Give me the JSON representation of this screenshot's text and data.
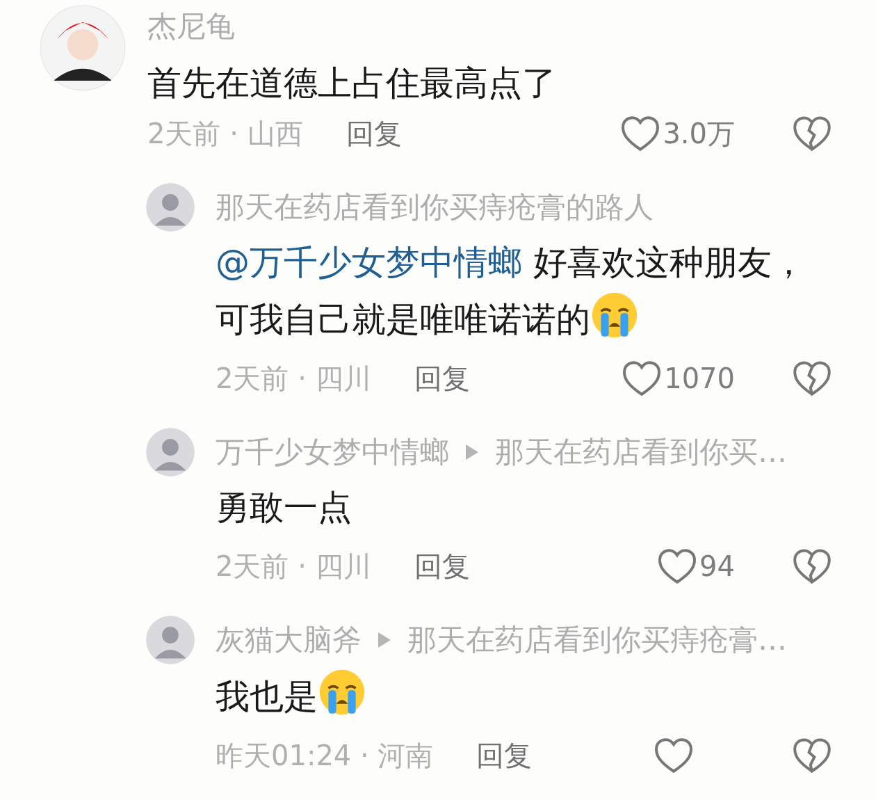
{
  "comments": [
    {
      "author": "杰尼龟",
      "kind": "comment",
      "text": "首先在道德上占住最高点了",
      "meta": "2天前 · 山西",
      "reply_label": "回复",
      "likes": "3.0万"
    },
    {
      "author": "那天在药店看到你买痔疮膏的路人",
      "kind": "reply",
      "mention": "@万千少女梦中情螂",
      "text": "好喜欢这种朋友，可我自己就是唯唯诺诺的",
      "trailing_emoji": true,
      "meta": "2天前 · 四川",
      "reply_label": "回复",
      "likes": "1070"
    },
    {
      "author": "万千少女梦中情螂",
      "reply_to": "那天在药店看到你买…",
      "kind": "reply",
      "text": "勇敢一点",
      "meta": "2天前 · 四川",
      "reply_label": "回复",
      "likes": "94"
    },
    {
      "author": "灰猫大脑斧",
      "reply_to": "那天在药店看到你买痔疮膏…",
      "kind": "reply",
      "text": "我也是",
      "trailing_emoji": true,
      "meta": "昨天01:24 · 河南",
      "reply_label": "回复"
    }
  ]
}
